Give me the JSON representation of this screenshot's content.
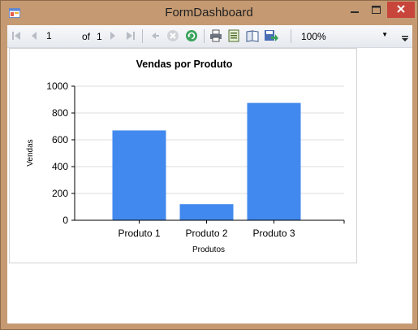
{
  "window": {
    "title": "FormDashboard"
  },
  "toolbar": {
    "page_current": "1",
    "page_of_label": "of",
    "page_total": "1",
    "zoom": "100%"
  },
  "icons": {
    "first": "first-page-icon",
    "prev": "previous-page-icon",
    "next": "next-page-icon",
    "last": "last-page-icon",
    "back": "back-icon",
    "stop": "stop-icon",
    "refresh": "refresh-icon",
    "print": "print-icon",
    "print_layout": "print-layout-icon",
    "page_setup": "page-setup-icon",
    "export": "export-icon"
  },
  "colors": {
    "bar": "#4189ee",
    "gridline": "#dcdcdc",
    "axis": "#000000"
  },
  "chart_data": {
    "type": "bar",
    "title": "Vendas por Produto",
    "xlabel": "Produtos",
    "ylabel": "Vendas",
    "categories": [
      "Produto 1",
      "Produto 2",
      "Produto 3"
    ],
    "values": [
      670,
      120,
      875
    ],
    "ylim": [
      0,
      1000
    ],
    "yticks": [
      "0",
      "200",
      "400",
      "600",
      "800",
      "1000"
    ],
    "ytick_values": [
      0,
      200,
      400,
      600,
      800,
      1000
    ],
    "grid": true,
    "legend": "none"
  }
}
